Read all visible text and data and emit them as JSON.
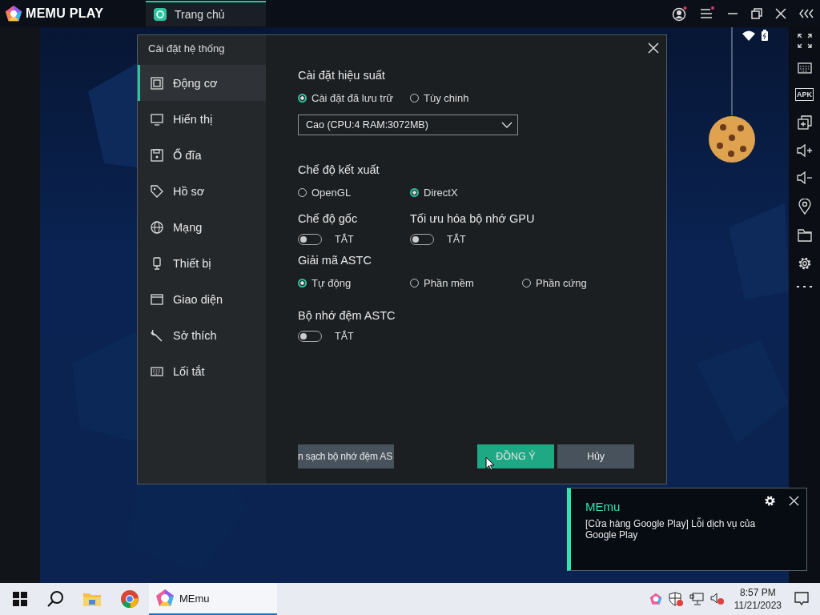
{
  "app_bar": {
    "logo": "MEMU PLAY",
    "tabs": [
      {
        "label": "Trang chủ",
        "selected": true
      }
    ]
  },
  "side_toolbar": {
    "apk_label": "APK"
  },
  "dialog": {
    "title": "Cài đặt hệ thống",
    "sidebar": [
      {
        "label": "Động cơ",
        "selected": true
      },
      {
        "label": "Hiển thị",
        "selected": false
      },
      {
        "label": "Ổ đĩa",
        "selected": false
      },
      {
        "label": "Hồ sơ",
        "selected": false
      },
      {
        "label": "Mạng",
        "selected": false
      },
      {
        "label": "Thiết bị",
        "selected": false
      },
      {
        "label": "Giao diện",
        "selected": false
      },
      {
        "label": "Sở thích",
        "selected": false
      },
      {
        "label": "Lối tắt",
        "selected": false
      }
    ],
    "sections": [
      {
        "kind": "radio",
        "title": "Cài đặt hiệu suất",
        "options": [
          {
            "label": "Cài đặt đã lưu trữ",
            "selected": true
          },
          {
            "label": "Tùy chinh",
            "selected": false
          }
        ]
      },
      {
        "kind": "select",
        "value": "Cao (CPU:4 RAM:3072MB)"
      },
      {
        "kind": "radio",
        "title": "Chế độ kết xuất",
        "options": [
          {
            "label": "OpenGL",
            "selected": false
          },
          {
            "label": "DirectX",
            "selected": true
          }
        ]
      },
      {
        "kind": "toggles",
        "items": [
          {
            "title": "Chế độ gốc",
            "on": false,
            "state_label": "TẮT"
          },
          {
            "title": "Tối ưu hóa bộ nhớ GPU",
            "on": false,
            "state_label": "TẮT"
          }
        ]
      },
      {
        "kind": "radio",
        "title": "Giải mã ASTC",
        "options": [
          {
            "label": "Tự động",
            "selected": true
          },
          {
            "label": "Phần mềm",
            "selected": false
          },
          {
            "label": "Phần cứng",
            "selected": false
          }
        ]
      },
      {
        "kind": "toggles",
        "items": [
          {
            "title": "Bộ nhớ đệm ASTC",
            "on": false,
            "state_label": "TẮT"
          }
        ]
      }
    ],
    "clear_button": "n sạch bộ nhớ đệm AS",
    "ok_button": "ĐỒNG Ý",
    "cancel_button": "Hủy"
  },
  "notification": {
    "title": "MEmu",
    "message": "[Cửa hàng Google Play] Lỗi dịch vụ của Google Play"
  },
  "taskbar": {
    "apps": [
      {
        "label": "MEmu",
        "selected": true
      }
    ],
    "time": "8:57 PM",
    "date": "11/21/2023"
  }
}
